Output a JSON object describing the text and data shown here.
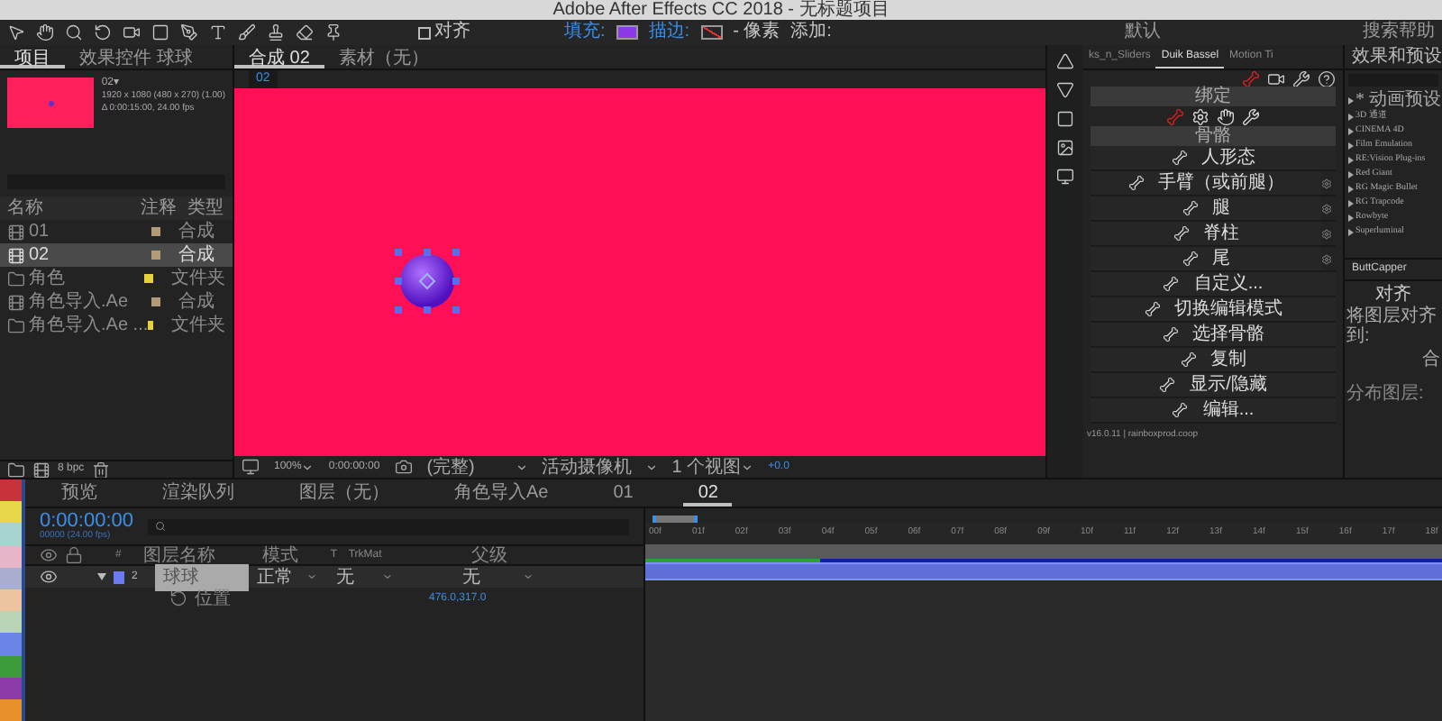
{
  "window": {
    "title": "Adobe After Effects CC 2018 - 无标题项目"
  },
  "toolbar": {
    "align": {
      "label": "对齐",
      "checked": false
    },
    "fill_label": "填充:",
    "stroke_label": "描边:",
    "stroke_unit": "- 像素",
    "add_label": "添加:",
    "workspace": "默认",
    "search": "搜索帮助"
  },
  "project_panel": {
    "tabs": [
      {
        "label": "项目",
        "selected": true
      },
      {
        "label": "效果控件 球球",
        "selected": false
      }
    ],
    "comp_name": "02▾",
    "info": [
      "1920 x 1080 (480 x 270) (1.00)",
      "Δ 0:00:15:00, 24.00 fps"
    ],
    "columns": [
      "名称",
      "注释",
      "类型"
    ],
    "rows": [
      {
        "name": "01",
        "type": "合成",
        "kind": "comp",
        "color": "#b39b78",
        "selected": false
      },
      {
        "name": "02",
        "type": "合成",
        "kind": "comp",
        "color": "#b39b78",
        "selected": true
      },
      {
        "name": "角色",
        "type": "文件夹",
        "kind": "folder",
        "color": "#e8d23c",
        "selected": false
      },
      {
        "name": "角色导入.Ae",
        "type": "合成",
        "kind": "comp",
        "color": "#b39b78",
        "selected": false
      },
      {
        "name": "角色导入.Ae ...",
        "type": "文件夹",
        "kind": "folder",
        "color": "#e8d23c",
        "selected": false
      }
    ],
    "bpc": "8 bpc"
  },
  "viewer": {
    "tabs": [
      {
        "label": "合成 02",
        "selected": true
      },
      {
        "label": "素材（无）",
        "selected": false
      }
    ],
    "breadcrumb": "02",
    "zoom": "100%",
    "time": "0:00:00:00",
    "resolution": "(完整)",
    "camera": "活动摄像机",
    "views": "1 个视图",
    "exposure": "+0.0"
  },
  "duik": {
    "tabs": [
      {
        "label": "ks_n_Sliders",
        "selected": false
      },
      {
        "label": "Duik Bassel",
        "selected": true
      },
      {
        "label": "Motion Ti",
        "selected": false
      }
    ],
    "rig_section": "绑定",
    "bones_section": "骨骼",
    "items": [
      {
        "label": "人形态",
        "gear": false
      },
      {
        "label": "手臂（或前腿）",
        "gear": true
      },
      {
        "label": "腿",
        "gear": true
      },
      {
        "label": "脊柱",
        "gear": true
      },
      {
        "label": "尾",
        "gear": true
      },
      {
        "label": "自定义...",
        "gear": false
      },
      {
        "label": "切换编辑模式",
        "gear": false
      },
      {
        "label": "选择骨骼",
        "gear": false
      },
      {
        "label": "复制",
        "gear": false
      },
      {
        "label": "显示/隐藏",
        "gear": false
      },
      {
        "label": "编辑...",
        "gear": false
      }
    ],
    "version": "v16.0.11 | rainboxprod.coop"
  },
  "effects": {
    "title": "效果和预设",
    "items": [
      "* 动画预设",
      "3D 通道",
      "CINEMA 4D",
      "Film Emulation",
      "RE:Vision Plug-ins",
      "Red Giant",
      "RG Magic Bullet",
      "RG Trapcode",
      "Rowbyte",
      "Superluminal"
    ]
  },
  "buttcapper": {
    "title": "ButtCapper"
  },
  "align": {
    "title": "对齐",
    "align_to_label": "将图层对齐到:",
    "align_to_value": "合",
    "distribute_label": "分布图层:"
  },
  "label_colors": [
    {
      "color": "#c8323c"
    },
    {
      "color": "#e6d84a"
    },
    {
      "color": "#a8d4d0"
    },
    {
      "color": "#e6b6c8"
    },
    {
      "color": "#a8aed0"
    },
    {
      "color": "#ecc4a0"
    },
    {
      "color": "#b8d4b4"
    },
    {
      "color": "#6c84e8"
    },
    {
      "color": "#3c9c3c"
    },
    {
      "color": "#8c3ca8"
    },
    {
      "color": "#e8902c"
    }
  ],
  "timeline": {
    "tabs": [
      {
        "label": "预览",
        "selected": false
      },
      {
        "label": "渲染队列",
        "selected": false
      },
      {
        "label": "图层（无）",
        "selected": false
      },
      {
        "label": "角色导入Ae",
        "selected": false
      },
      {
        "label": "01",
        "selected": false
      },
      {
        "label": "02",
        "selected": true
      }
    ],
    "timecode": "0:00:00:00",
    "fps": "00000 (24.00 fps)",
    "columns": [
      "#",
      "图层名称",
      "模式",
      "T",
      "TrkMat",
      "父级"
    ],
    "layer": {
      "number": "2",
      "name": "球球",
      "mode": "正常",
      "trkmat": "无",
      "parent": "无",
      "color": "#6c7cf0",
      "expanded": true
    },
    "property": {
      "name": "位置",
      "value": "476.0,317.0"
    },
    "ticks": [
      "00f",
      "01f",
      "02f",
      "03f",
      "04f",
      "05f",
      "06f",
      "07f",
      "08f",
      "09f",
      "10f",
      "11f",
      "12f",
      "13f",
      "14f",
      "15f",
      "16f",
      "17f",
      "18f"
    ]
  }
}
